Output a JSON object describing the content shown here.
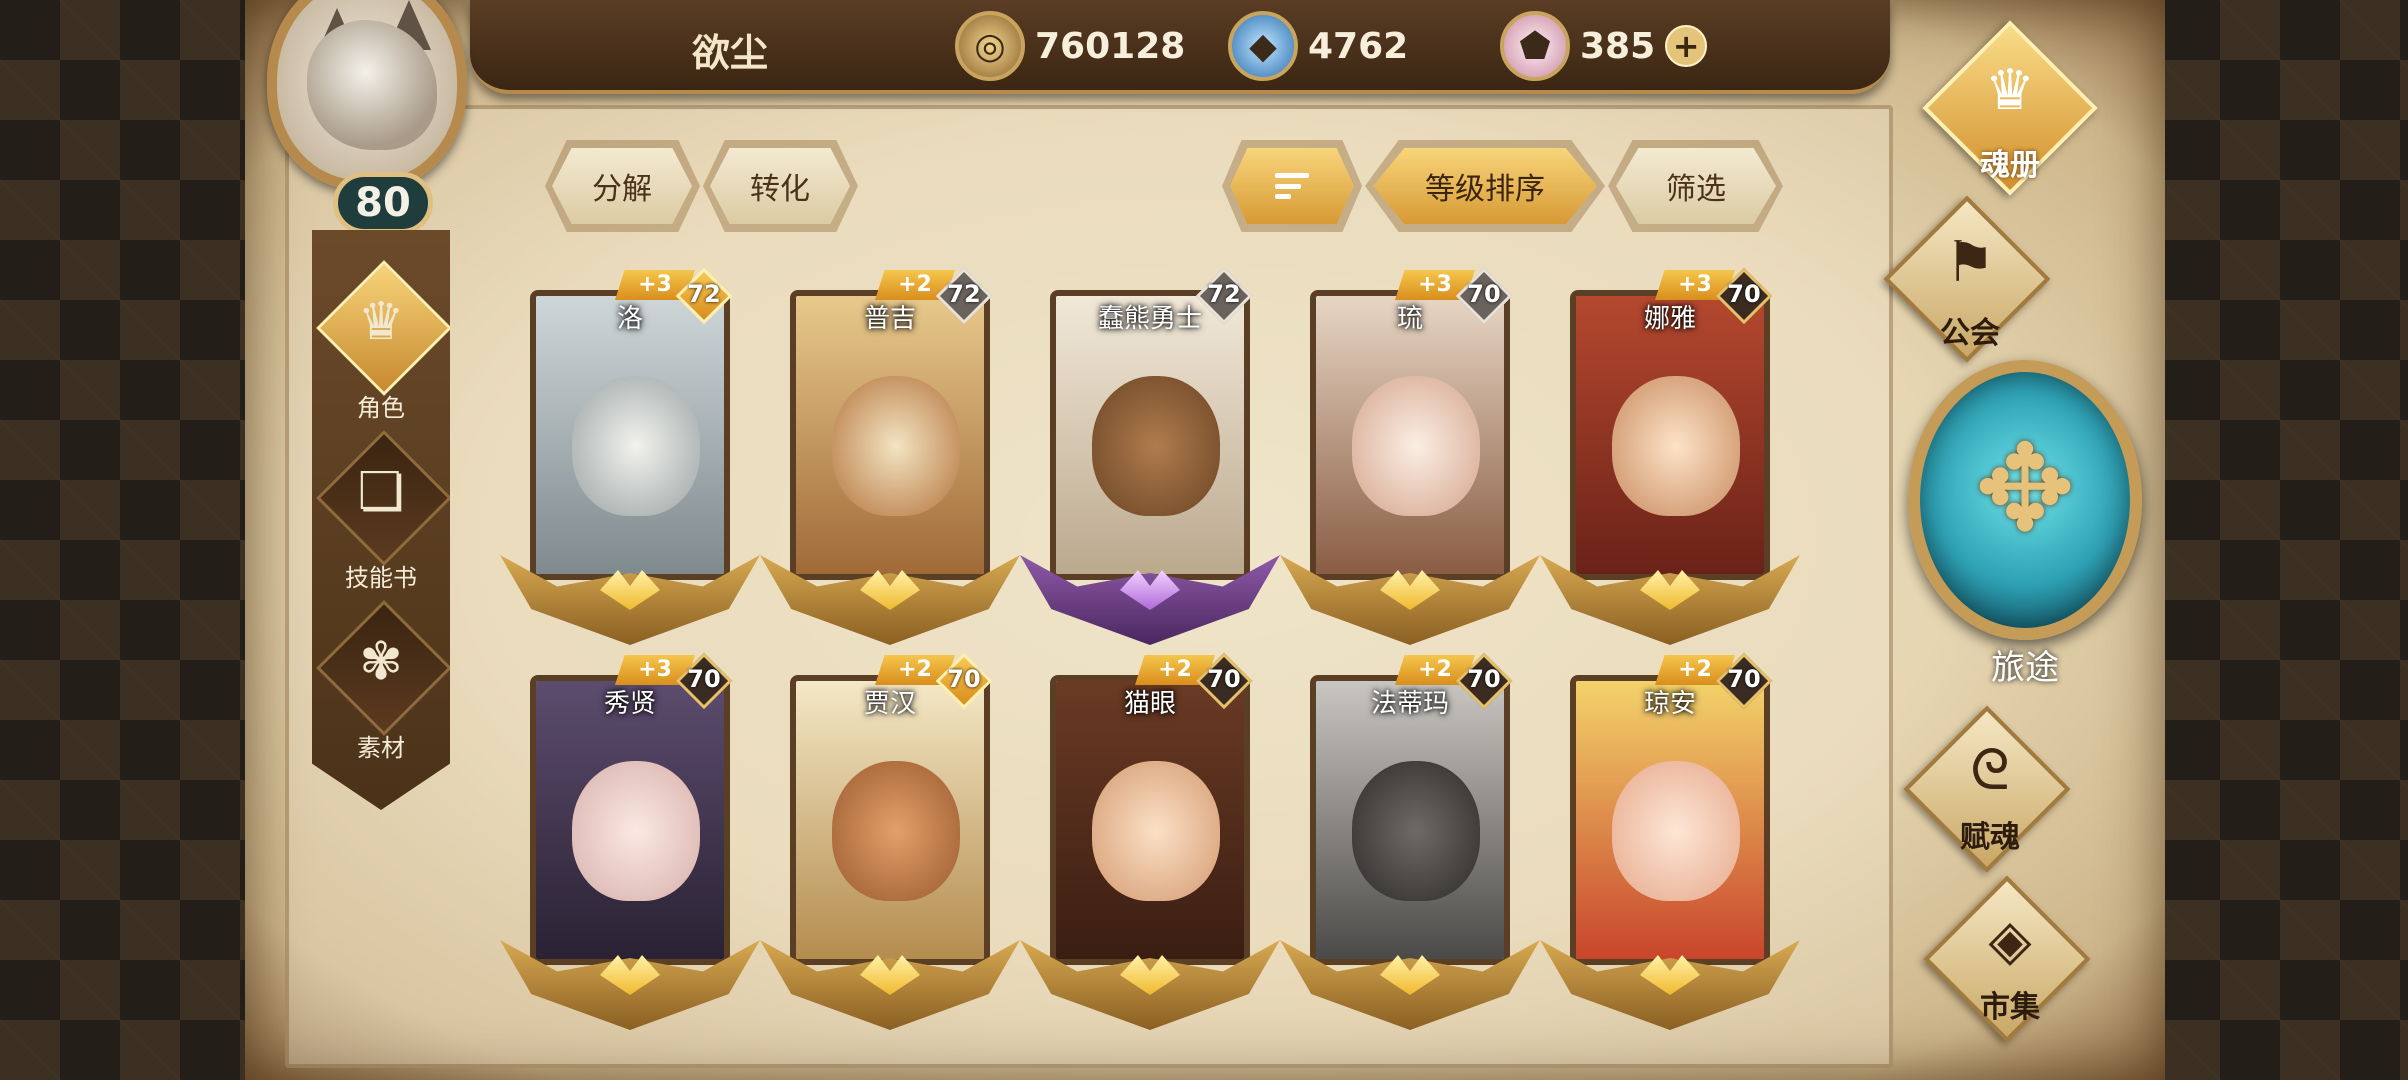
{
  "player": {
    "name": "欲尘",
    "level": "80"
  },
  "currencies": [
    {
      "icon": "gold-coin-icon",
      "value": "760128"
    },
    {
      "icon": "blue-crystal-icon",
      "value": "4762"
    },
    {
      "icon": "pink-gem-icon",
      "value": "385",
      "plus": "+"
    }
  ],
  "actions": {
    "decompose": "分解",
    "convert": "转化",
    "sort_by_level": "等级排序",
    "filter": "筛选"
  },
  "left_menu": [
    {
      "label": "角色",
      "icon": "character-helm-icon",
      "active": true
    },
    {
      "label": "技能书",
      "icon": "skill-book-icon",
      "active": false
    },
    {
      "label": "素材",
      "icon": "material-icon",
      "active": false
    }
  ],
  "right_menu": {
    "soul_book": "魂册",
    "guild": "公会",
    "journey": "旅途",
    "soul_grant": "赋魂",
    "market": "市集"
  },
  "heroes": [
    {
      "name": "洛",
      "plus": "+3",
      "level": "72",
      "level_style": "gold",
      "base": "gold"
    },
    {
      "name": "普吉",
      "plus": "+2",
      "level": "72",
      "level_style": "grey",
      "base": "gold"
    },
    {
      "name": "蠢熊勇士",
      "plus": "",
      "level": "72",
      "level_style": "grey",
      "base": "purple"
    },
    {
      "name": "琉",
      "plus": "+3",
      "level": "70",
      "level_style": "grey",
      "base": "gold"
    },
    {
      "name": "娜雅",
      "plus": "+3",
      "level": "70",
      "level_style": "dark",
      "base": "gold"
    },
    {
      "name": "秀贤",
      "plus": "+3",
      "level": "70",
      "level_style": "dark",
      "base": "gold"
    },
    {
      "name": "贾汉",
      "plus": "+2",
      "level": "70",
      "level_style": "gold",
      "base": "gold"
    },
    {
      "name": "猫眼",
      "plus": "+2",
      "level": "70",
      "level_style": "dark",
      "base": "gold"
    },
    {
      "name": "法蒂玛",
      "plus": "+2",
      "level": "70",
      "level_style": "dark",
      "base": "gold"
    },
    {
      "name": "琼安",
      "plus": "+2",
      "level": "70",
      "level_style": "dark",
      "base": "gold"
    }
  ]
}
